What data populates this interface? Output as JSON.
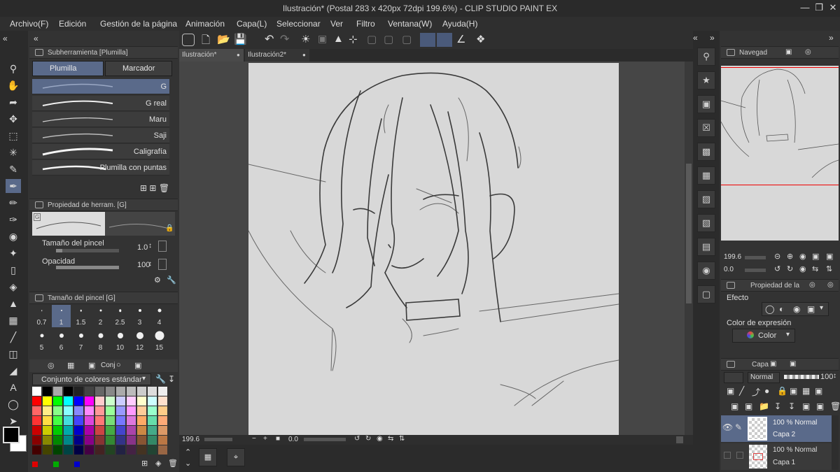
{
  "window": {
    "title": "Ilustración* (Postal 283 x 420px 72dpi 199.6%) - CLIP STUDIO PAINT EX",
    "minimize_icon": "minimize-icon",
    "maximize_icon": "restore-icon",
    "close_icon": "close-icon"
  },
  "menu": [
    "Archivo(F)",
    "Edición",
    "Gestión de la página",
    "Animación",
    "Capa(L)",
    "Seleccionar",
    "Ver",
    "Filtro",
    "Ventana(W)",
    "Ayuda(H)"
  ],
  "subtool": {
    "header": "Subherramienta [Plumilla]",
    "tabs": [
      "Plumilla",
      "Marcador"
    ],
    "brushes": [
      "G",
      "G real",
      "Maru",
      "Saji",
      "Caligrafía",
      "Plumilla con puntas"
    ]
  },
  "tool_property": {
    "header": "Propiedad de herram. [G]",
    "preset_badge": "G",
    "brush_size_label": "Tamaño del pincel",
    "brush_size_value": "1.0",
    "opacity_label": "Opacidad",
    "opacity_value": "100",
    "brush_size_fraction": 0.1,
    "opacity_fraction": 1.0
  },
  "brush_size_palette": {
    "header": "Tamaño del pincel [G]",
    "sizes": [
      "0.7",
      "1",
      "1.5",
      "2",
      "2.5",
      "3",
      "4",
      "5",
      "6",
      "7",
      "8",
      "10",
      "12",
      "15"
    ],
    "selected": "1"
  },
  "color_set": {
    "tab_label": "Conj",
    "dropdown": "Conjunto de colores estándar"
  },
  "document_tabs": [
    "Ilustración*",
    "Ilustración2*"
  ],
  "status": {
    "zoom": "199.6",
    "rotation": "0.0"
  },
  "navigator": {
    "header": "Navegad",
    "zoom": "199.6",
    "rotation": "0.0"
  },
  "layer_property": {
    "header": "Propiedad de la",
    "effect_label": "Efecto",
    "expression_label": "Color de expresión",
    "expression_value": "Color"
  },
  "layers": {
    "header": "Capa",
    "blend_mode": "Normal",
    "opacity": "100",
    "items": [
      {
        "mode": "100 % Normal",
        "name": "Capa 2",
        "selected": true
      },
      {
        "mode": "100 % Normal",
        "name": "Capa 1",
        "selected": false
      }
    ]
  },
  "colors": {
    "main_color": "#000000",
    "sub_color": "#ffffff",
    "accent": "#5a6a8a",
    "canvas_paper": "#d8d8d8"
  }
}
